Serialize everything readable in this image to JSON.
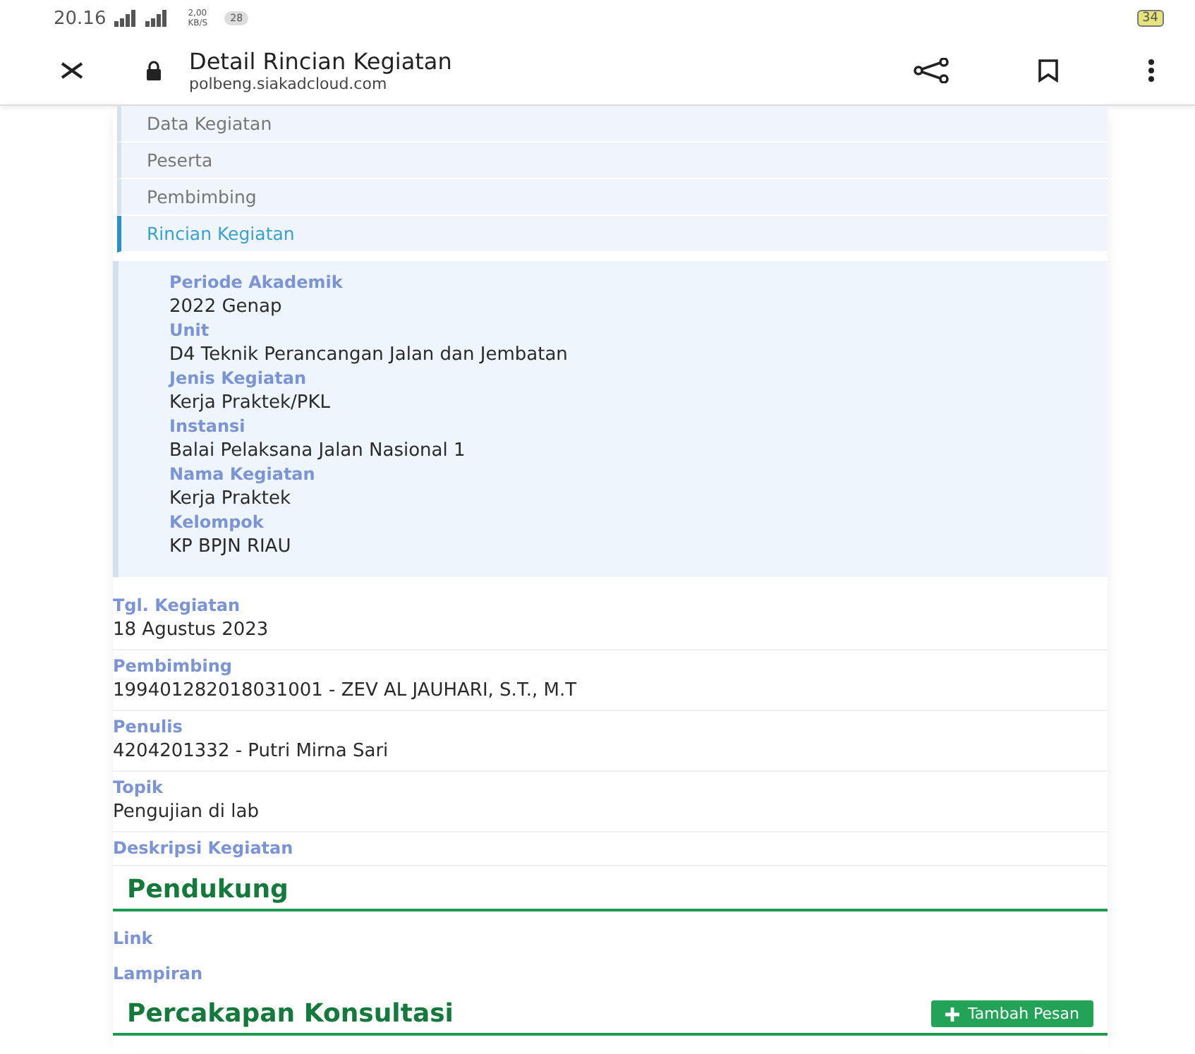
{
  "status_bar": {
    "time": "20.16",
    "net_speed": "2,00",
    "net_unit": "KB/S",
    "notification_count": "28",
    "battery": "34"
  },
  "toolbar": {
    "title": "Detail Rincian Kegiatan",
    "url": "polbeng.siakadcloud.com"
  },
  "nav": {
    "items": [
      {
        "label": "Data Kegiatan",
        "selected": false
      },
      {
        "label": "Peserta",
        "selected": false
      },
      {
        "label": "Pembimbing",
        "selected": false
      },
      {
        "label": "Rincian Kegiatan",
        "selected": true
      }
    ]
  },
  "info_box": {
    "fields": [
      {
        "label": "Periode Akademik",
        "value": "2022 Genap"
      },
      {
        "label": "Unit",
        "value": "D4 Teknik Perancangan Jalan dan Jembatan"
      },
      {
        "label": "Jenis Kegiatan",
        "value": "Kerja Praktek/PKL"
      },
      {
        "label": "Instansi",
        "value": "Balai Pelaksana Jalan Nasional 1"
      },
      {
        "label": "Nama Kegiatan",
        "value": "Kerja Praktek"
      },
      {
        "label": "Kelompok",
        "value": "KP BPJN RIAU"
      }
    ]
  },
  "details": [
    {
      "label": "Tgl. Kegiatan",
      "value": "18 Agustus 2023"
    },
    {
      "label": "Pembimbing",
      "value": "199401282018031001 - ZEV AL JAUHARI, S.T., M.T"
    },
    {
      "label": "Penulis",
      "value": "4204201332 - Putri Mirna Sari"
    },
    {
      "label": "Topik",
      "value": "Pengujian di lab"
    },
    {
      "label": "Deskripsi Kegiatan"
    }
  ],
  "pendukung": {
    "title": "Pendukung",
    "items": [
      "Link",
      "Lampiran"
    ]
  },
  "percakapan": {
    "title": "Percakapan Konsultasi",
    "button": "Tambah Pesan"
  }
}
